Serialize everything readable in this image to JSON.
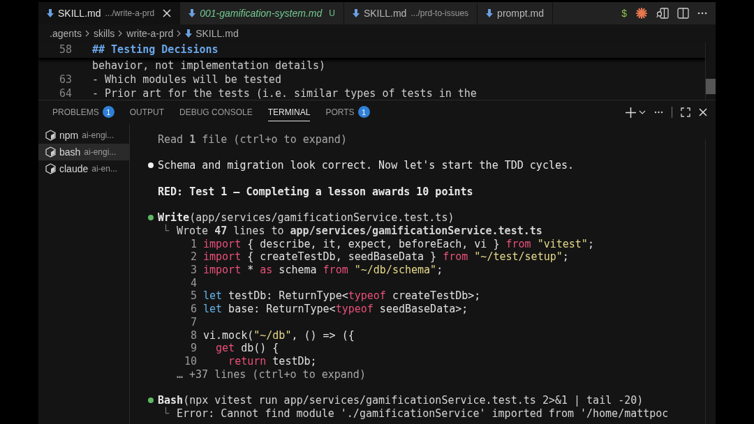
{
  "editor_tabs": [
    {
      "label": "SKILL.md",
      "detail": ".../write-a-prd",
      "selected": true,
      "preview": false,
      "closable": true
    },
    {
      "label": "001-gamification-system.md",
      "selected": false,
      "preview": true,
      "status": "U",
      "closable": false
    },
    {
      "label": "SKILL.md",
      "detail": ".../prd-to-issues",
      "selected": false,
      "preview": false,
      "closable": false
    },
    {
      "label": "prompt.md",
      "selected": false,
      "preview": false,
      "closable": false
    }
  ],
  "cut_tab_label": "$",
  "breadcrumb": [
    ".agents",
    "skills",
    "write-a-prd",
    "SKILL.md"
  ],
  "editor": {
    "sticky": {
      "number": "58",
      "text": "## Testing Decisions"
    },
    "lines": [
      {
        "text": "behavior, not implementation details)"
      },
      {
        "number": "63",
        "text": "- Which modules will be tested"
      },
      {
        "number": "64",
        "text": "- Prior art for the tests (i.e. similar types of tests in the"
      }
    ]
  },
  "panel_tabs": [
    {
      "label": "PROBLEMS",
      "badge": "1",
      "selected": false
    },
    {
      "label": "OUTPUT",
      "selected": false
    },
    {
      "label": "DEBUG CONSOLE",
      "selected": false
    },
    {
      "label": "TERMINAL",
      "selected": true
    },
    {
      "label": "PORTS",
      "badge": "1",
      "selected": false
    }
  ],
  "terminals": [
    {
      "name": "npm",
      "detail": "ai-engi...",
      "selected": false
    },
    {
      "name": "bash",
      "detail": "ai-engi...",
      "selected": true
    },
    {
      "name": "claude",
      "detail": "ai-en...",
      "selected": false
    }
  ],
  "output": [
    {
      "kind": "note",
      "text": "Read **1** file (ctrl+o to expand)"
    },
    {
      "kind": "message",
      "text": "Schema and migration look correct. Now let's start the TDD cycles."
    },
    {
      "kind": "heading",
      "text": "RED: Test 1 — Completing a lesson awards 10 points"
    },
    {
      "kind": "tool",
      "name": "Write",
      "args": "(app/services/gamificationService.test.ts)"
    },
    {
      "kind": "result",
      "corner": "└",
      "text": "Wrote **47** lines to **app/services/gamificationService.test.ts**"
    },
    {
      "kind": "code",
      "lines": [
        {
          "number": "1",
          "tokens": [
            {
              "text": "import",
              "kind": "kw"
            },
            {
              "text": " { describe, it, expect, beforeEach, vi } ",
              "kind": "plain"
            },
            {
              "text": "from",
              "kind": "kw"
            },
            {
              "text": " \"vitest\"",
              "kind": "str"
            },
            {
              "text": ";",
              "kind": "plain"
            }
          ]
        },
        {
          "number": "2",
          "tokens": [
            {
              "text": "import",
              "kind": "kw"
            },
            {
              "text": " { createTestDb, seedBaseData } ",
              "kind": "plain"
            },
            {
              "text": "from",
              "kind": "kw"
            },
            {
              "text": " \"~/test/setup\"",
              "kind": "str"
            },
            {
              "text": ";",
              "kind": "plain"
            }
          ]
        },
        {
          "number": "3",
          "tokens": [
            {
              "text": "import",
              "kind": "kw"
            },
            {
              "text": " * ",
              "kind": "plain"
            },
            {
              "text": "as",
              "kind": "kw"
            },
            {
              "text": " schema ",
              "kind": "plain"
            },
            {
              "text": "from",
              "kind": "kw"
            },
            {
              "text": " \"~/db/schema\"",
              "kind": "str"
            },
            {
              "text": ";",
              "kind": "plain"
            }
          ]
        },
        {
          "number": "4"
        },
        {
          "number": "5",
          "tokens": [
            {
              "text": "let",
              "kind": "decl"
            },
            {
              "text": " testDb: ReturnType<",
              "kind": "plain"
            },
            {
              "text": "typeof",
              "kind": "kw"
            },
            {
              "text": " createTestDb>;",
              "kind": "plain"
            }
          ]
        },
        {
          "number": "6",
          "tokens": [
            {
              "text": "let",
              "kind": "decl"
            },
            {
              "text": " base: ReturnType<",
              "kind": "plain"
            },
            {
              "text": "typeof",
              "kind": "kw"
            },
            {
              "text": " seedBaseData>;",
              "kind": "plain"
            }
          ]
        },
        {
          "number": "7"
        },
        {
          "number": "8",
          "tokens": [
            {
              "text": "vi.mock(",
              "kind": "plain"
            },
            {
              "text": "\"~/db\"",
              "kind": "str"
            },
            {
              "text": ", () => ({",
              "kind": "plain"
            }
          ]
        },
        {
          "number": "9",
          "tokens": [
            {
              "text": "  get",
              "kind": "kw"
            },
            {
              "text": " db() {",
              "kind": "plain"
            }
          ]
        },
        {
          "number": "10",
          "tokens": [
            {
              "text": "    return",
              "kind": "kw"
            },
            {
              "text": " testDb;",
              "kind": "plain"
            }
          ]
        }
      ]
    },
    {
      "kind": "more",
      "text": "… +37 lines (ctrl+o to expand)"
    },
    {
      "kind": "tool",
      "name": "Bash",
      "args": "(npx vitest run app/services/gamificationService.test.ts 2>&1 | tail -20)"
    },
    {
      "kind": "result",
      "corner": "└",
      "text": "Error: Cannot find module './gamificationService' imported from '/home/mattpoc"
    }
  ]
}
